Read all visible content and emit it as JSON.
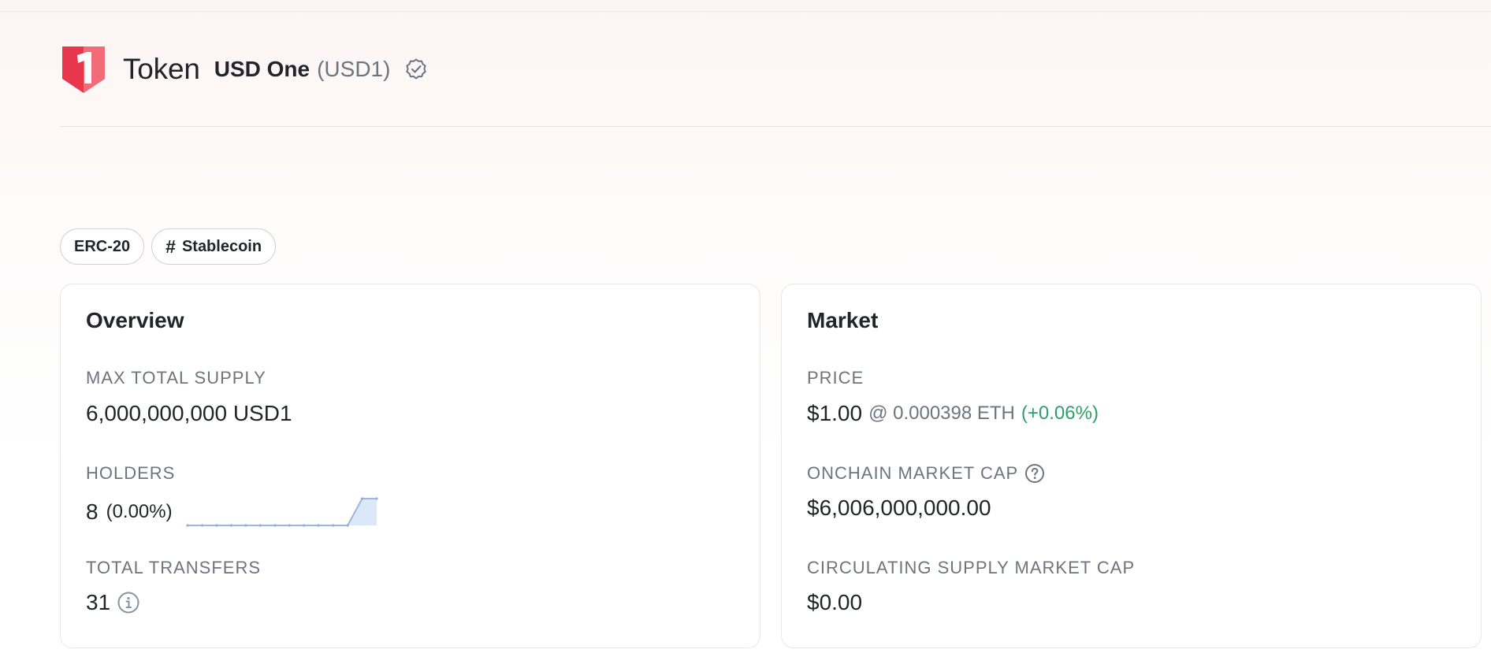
{
  "header": {
    "token_word": "Token",
    "token_name": "USD One",
    "token_symbol": "(USD1)",
    "logo_icon": "usd1-shield-logo",
    "verified_icon": "verified-check-icon",
    "brand_color": "#e63a4f"
  },
  "badges": {
    "standard": "ERC-20",
    "tag": "Stablecoin"
  },
  "overview": {
    "title": "Overview",
    "max_supply_label": "MAX TOTAL SUPPLY",
    "max_supply_value": "6,000,000,000 USD1",
    "holders_label": "HOLDERS",
    "holders_value": "8",
    "holders_pct": "(0.00%)",
    "holders_trend": [
      0,
      0,
      0,
      0,
      0,
      0,
      0,
      0,
      0,
      0,
      0,
      0,
      8,
      8
    ],
    "transfers_label": "TOTAL TRANSFERS",
    "transfers_value": "31",
    "transfers_icon": "info-icon"
  },
  "market": {
    "title": "Market",
    "price_label": "PRICE",
    "price_value": "$1.00",
    "price_eth": "@ 0.000398 ETH",
    "price_change": "(+0.06%)",
    "price_change_color": "#2e9e6e",
    "mcap_label": "ONCHAIN MARKET CAP",
    "mcap_icon": "help-circle-icon",
    "mcap_value": "$6,006,000,000.00",
    "circ_label": "CIRCULATING SUPPLY MARKET CAP",
    "circ_value": "$0.00"
  }
}
